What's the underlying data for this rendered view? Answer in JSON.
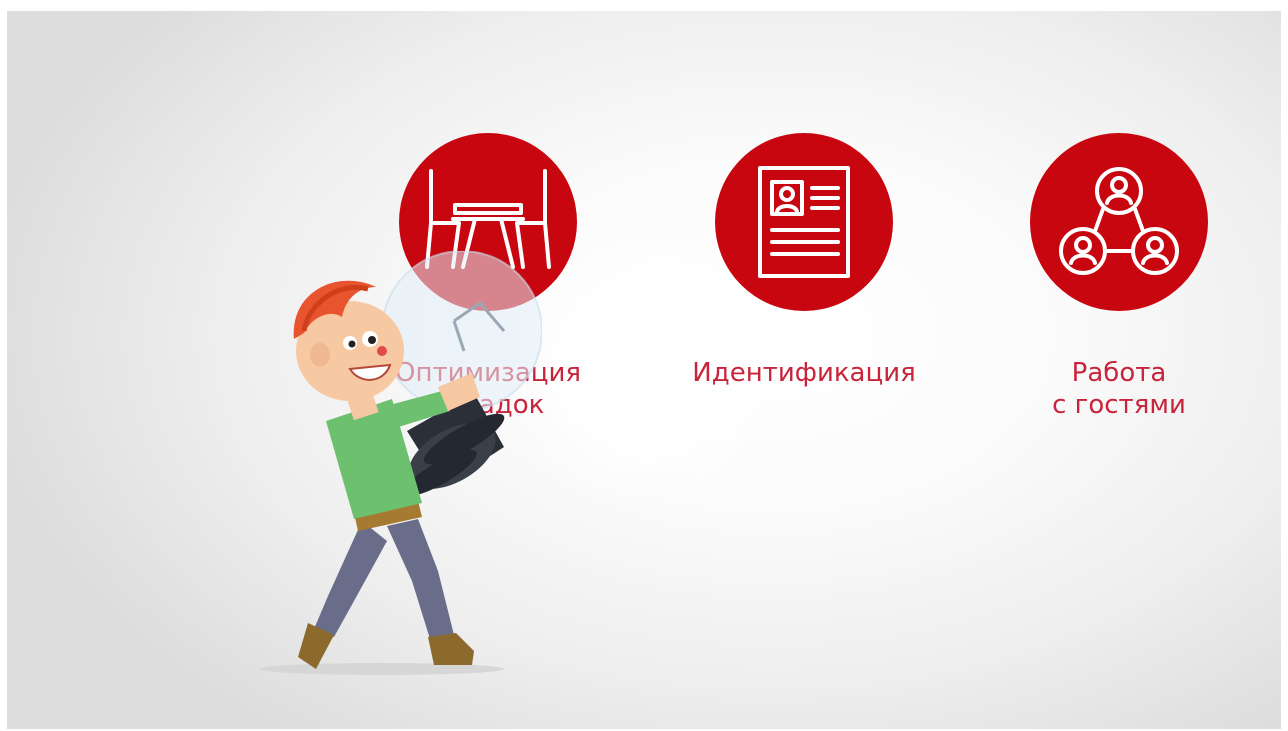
{
  "features": [
    {
      "icon": "table-chairs-icon",
      "label_lines": [
        "Оптимизация",
        "посадок"
      ]
    },
    {
      "icon": "id-card-icon",
      "label_lines": [
        "Идентификация"
      ]
    },
    {
      "icon": "guests-network-icon",
      "label_lines": [
        "Работа",
        "с гостями"
      ]
    }
  ],
  "colors": {
    "accent": "#c8060f",
    "label": "#c8243b",
    "background": "#f2f2f2"
  }
}
